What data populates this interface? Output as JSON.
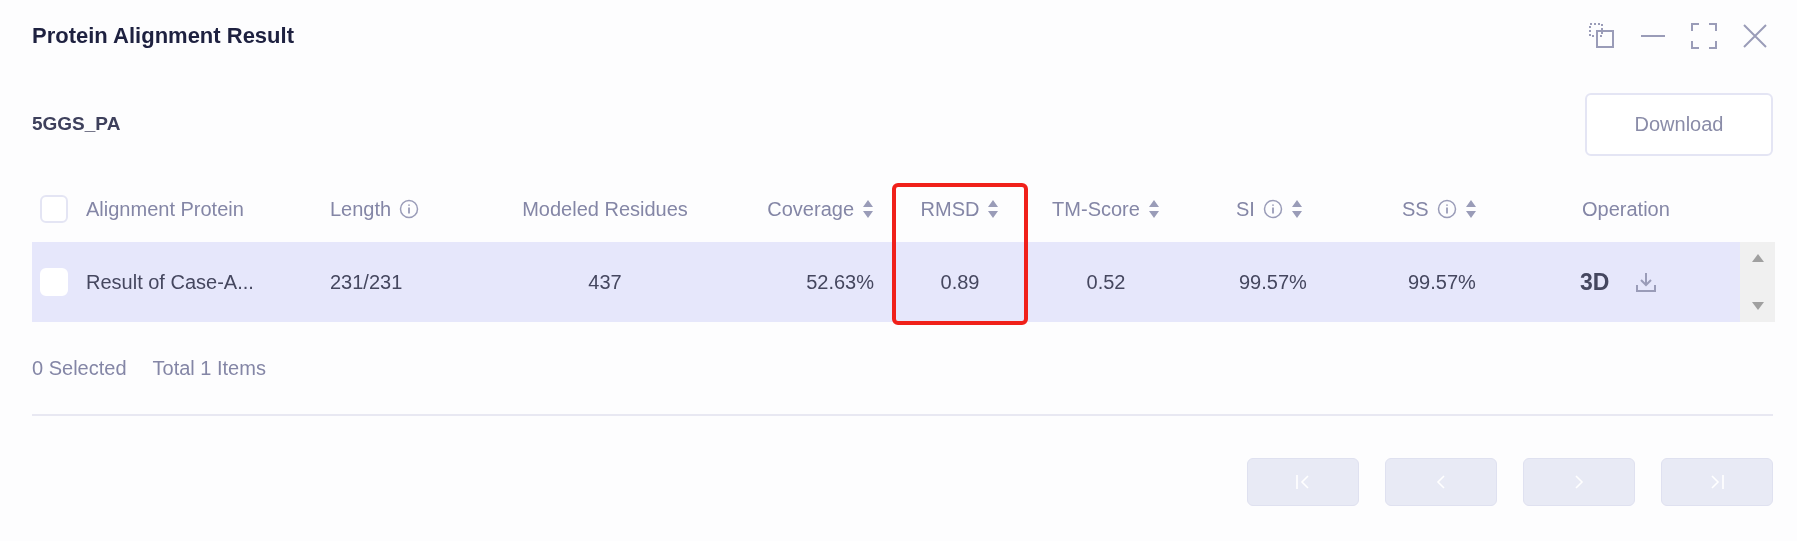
{
  "window": {
    "title": "Protein Alignment Result"
  },
  "dataset": {
    "name": "5GGS_PA"
  },
  "download_button": "Download",
  "table": {
    "all_checked": false,
    "columns": [
      {
        "label": "Alignment Protein",
        "kind": "plain"
      },
      {
        "label": "Length",
        "kind": "info"
      },
      {
        "label": "Modeled Residues",
        "kind": "plain"
      },
      {
        "label": "Coverage",
        "kind": "sort"
      },
      {
        "label": "RMSD",
        "kind": "sort"
      },
      {
        "label": "TM-Score",
        "kind": "sort"
      },
      {
        "label": "SI",
        "kind": "info-sort"
      },
      {
        "label": "SS",
        "kind": "info-sort"
      },
      {
        "label": "Operation",
        "kind": "plain"
      }
    ],
    "rows": [
      {
        "checked": false,
        "selected": true,
        "cells": [
          "Result of Case-A...",
          "231/231",
          "437",
          "52.63%",
          "0.89",
          "0.52",
          "99.57%",
          "99.57%"
        ],
        "action": "3D"
      }
    ]
  },
  "footer": {
    "selected": "0 Selected",
    "total": "Total 1 Items"
  },
  "pagination": [
    {
      "kind": "first",
      "disabled": true
    },
    {
      "kind": "prev",
      "disabled": true
    },
    {
      "kind": "next",
      "disabled": true
    },
    {
      "kind": "last",
      "disabled": true
    }
  ]
}
